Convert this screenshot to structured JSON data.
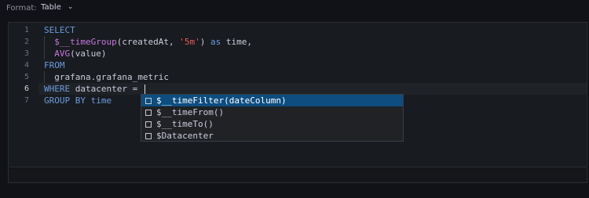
{
  "format": {
    "label": "Format:",
    "value": "Table"
  },
  "editor": {
    "line_numbers": [
      "1",
      "2",
      "3",
      "4",
      "5",
      "6",
      "7"
    ],
    "lines": [
      [
        {
          "t": "SELECT",
          "c": "kw"
        }
      ],
      [
        {
          "t": "  ",
          "c": "plain"
        },
        {
          "t": "$__timeGroup",
          "c": "fn-pink"
        },
        {
          "t": "(createdAt, ",
          "c": "plain"
        },
        {
          "t": "'5m'",
          "c": "str"
        },
        {
          "t": ") ",
          "c": "plain"
        },
        {
          "t": "as",
          "c": "kw"
        },
        {
          "t": " time,",
          "c": "plain"
        }
      ],
      [
        {
          "t": "  ",
          "c": "plain"
        },
        {
          "t": "AVG",
          "c": "fn-pink"
        },
        {
          "t": "(value)",
          "c": "plain"
        }
      ],
      [
        {
          "t": "FROM",
          "c": "kw"
        }
      ],
      [
        {
          "t": "  grafana.grafana_metric",
          "c": "plain"
        }
      ],
      [
        {
          "t": "WHERE",
          "c": "kw"
        },
        {
          "t": " datacenter = ",
          "c": "plain"
        }
      ],
      [
        {
          "t": "GROUP BY",
          "c": "kw"
        },
        {
          "t": " time",
          "c": "kw"
        }
      ]
    ]
  },
  "suggestions": [
    {
      "label": "$__timeFilter(dateColumn)",
      "selected": true
    },
    {
      "label": "$__timeFrom()",
      "selected": false
    },
    {
      "label": "$__timeTo()",
      "selected": false
    },
    {
      "label": "$Datacenter",
      "selected": false
    }
  ],
  "colors": {
    "keyword": "#6c9ce0",
    "function": "#c678dd",
    "string": "#ef5b5b",
    "selection": "#0d4d7f"
  }
}
